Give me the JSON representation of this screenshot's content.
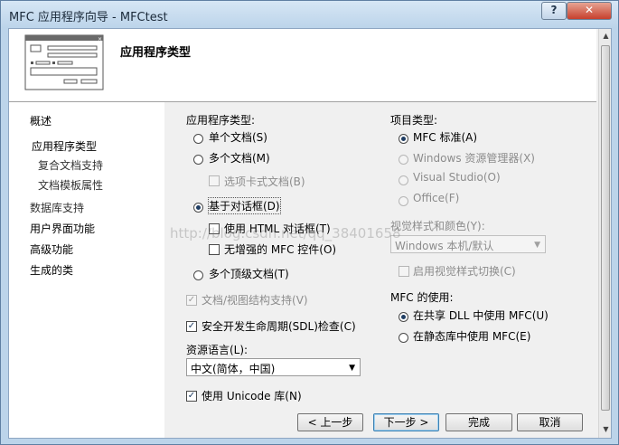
{
  "window": {
    "title": "MFC 应用程序向导 - MFCtest",
    "help_label": "?",
    "close_label": "✕"
  },
  "header": {
    "title": "应用程序类型",
    "icon": "wizard-dialog-icon"
  },
  "nav": {
    "items": [
      {
        "label": "概述"
      },
      {
        "label": "应用程序类型"
      },
      {
        "label": "复合文档支持"
      },
      {
        "label": "文档模板属性"
      },
      {
        "label": "数据库支持"
      },
      {
        "label": "用户界面功能"
      },
      {
        "label": "高级功能"
      },
      {
        "label": "生成的类"
      }
    ]
  },
  "app_type": {
    "label": "应用程序类型:",
    "single_doc": "单个文档(S)",
    "multi_doc": "多个文档(M)",
    "tabbed_docs": "选项卡式文档(B)",
    "dialog_based": "基于对话框(D)",
    "use_html_dialog": "使用 HTML 对话框(T)",
    "no_enhanced_mfc": "无增强的 MFC 控件(O)",
    "multi_top_level": "多个顶级文档(T)",
    "doc_view": "文档/视图结构支持(V)",
    "sdl": "安全开发生命周期(SDL)检查(C)",
    "resource_lang_label": "资源语言(L):",
    "resource_lang_value": "中文(简体，中国)",
    "use_unicode": "使用 Unicode 库(N)",
    "selected": "dialog_based"
  },
  "project_type": {
    "label": "项目类型:",
    "mfc_standard": "MFC 标准(A)",
    "windows_explorer": "Windows 资源管理器(X)",
    "visual_studio": "Visual Studio(O)",
    "office": "Office(F)",
    "selected": "mfc_standard"
  },
  "visual_style": {
    "label": "视觉样式和颜色(Y):",
    "value": "Windows 本机/默认",
    "enable_switch": "启用视觉样式切换(C)"
  },
  "mfc_use": {
    "label": "MFC 的使用:",
    "shared_dll": "在共享 DLL 中使用 MFC(U)",
    "static_lib": "在静态库中使用 MFC(E)",
    "selected": "shared_dll"
  },
  "buttons": {
    "prev": "< 上一步",
    "next": "下一步 >",
    "finish": "完成",
    "cancel": "取消"
  },
  "watermark": "http://blog.csdn.net/qq_38401658",
  "colors": {
    "title_bar": "#bcd4ea",
    "close_button": "#c7402d",
    "radio_dot": "#1f3d63",
    "default_button_border": "#3c7fb1"
  }
}
